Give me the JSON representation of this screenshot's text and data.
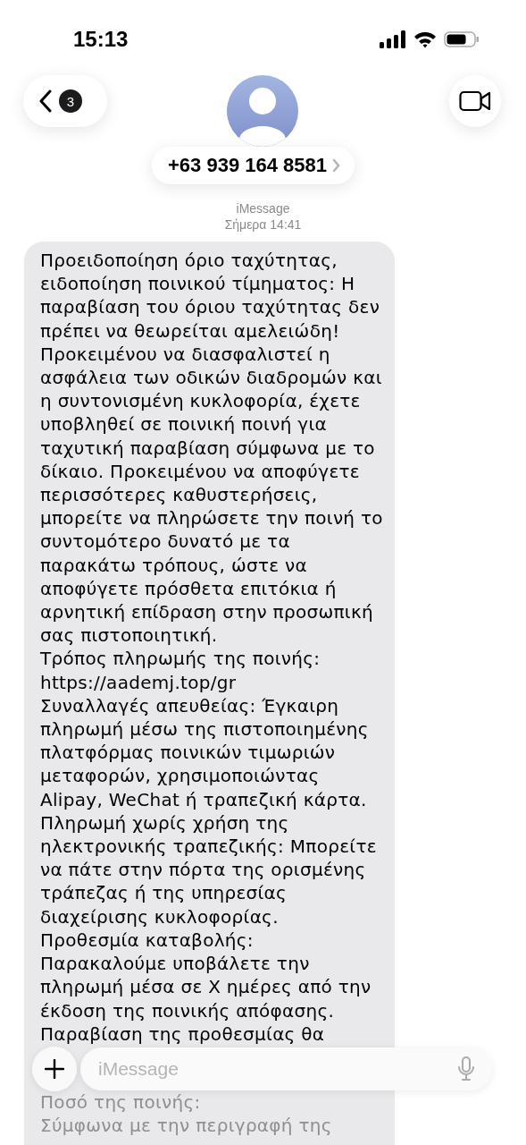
{
  "status_bar": {
    "time": "15:13"
  },
  "header": {
    "unread_count": "3",
    "contact": "+63 939 164 8581"
  },
  "conversation": {
    "service": "iMessage",
    "timestamp": "Σήμερα 14:41"
  },
  "message": {
    "paragraphs": [
      {
        "text": "Προειδοποίηση όριο ταχύτητας, ειδοποίηση ποινικού τίμηματος: Η παραβίαση του όριου ταχύτητας δεν πρέπει να θεωρείται αμελειώδη! Προκειμένου να διασφαλιστεί η ασφάλεια των οδικών διαδρομών και η συντονισμένη κυκλοφορία, έχετε υποβληθεί σε ποινική ποινή για ταχυτική παραβίαση σύμφωνα με το δίκαιο. Προκειμένου να αποφύγετε περισσότερες καθυστερήσεις, μπορείτε να πληρώσετε την ποινή το συντομότερο δυνατό με τα παρακάτω τρόπους, ώστε να αποφύγετε πρόσθετα επιτόκια ή αρνητική επίδραση στην προσωπική σας πιστοποιητική.",
        "faded": false
      },
      {
        "text": "Τρόπος πληρωμής της ποινής:",
        "faded": false
      },
      {
        "text": "https://aademj.top/gr",
        "faded": false
      },
      {
        "text": "Συναλλαγές απευθείας: Έγκαιρη πληρωμή μέσω της πιστοποιημένης πλατφόρμας ποινικών τιμωριών μεταφορών, χρησιμοποιώντας Alipay, WeChat ή τραπεζική κάρτα.",
        "faded": false
      },
      {
        "text": "Πληρωμή χωρίς χρήση της ηλεκτρονικής τραπεζικής: Μπορείτε να πάτε στην πόρτα της ορισμένης τράπεζας ή της υπηρεσίας διαχείρισης κυκλοφορίας.",
        "faded": false
      },
      {
        "text": "Προθεσμία καταβολής:",
        "faded": false
      },
      {
        "text": "Παρακαλούμε υποβάλετε την πληρωμή μέσα σε Χ ημέρες από την έκδοση της ποινικής απόφασης.",
        "faded": false
      },
      {
        "text": "Παραβίαση της προθεσμίας θα",
        "faded": false
      },
      {
        "text": "Ποσό της ποινής:",
        "faded": true
      },
      {
        "text": "Σύμφωνα με την περιγραφή της",
        "faded": true
      }
    ]
  },
  "composer": {
    "placeholder": "iMessage"
  }
}
